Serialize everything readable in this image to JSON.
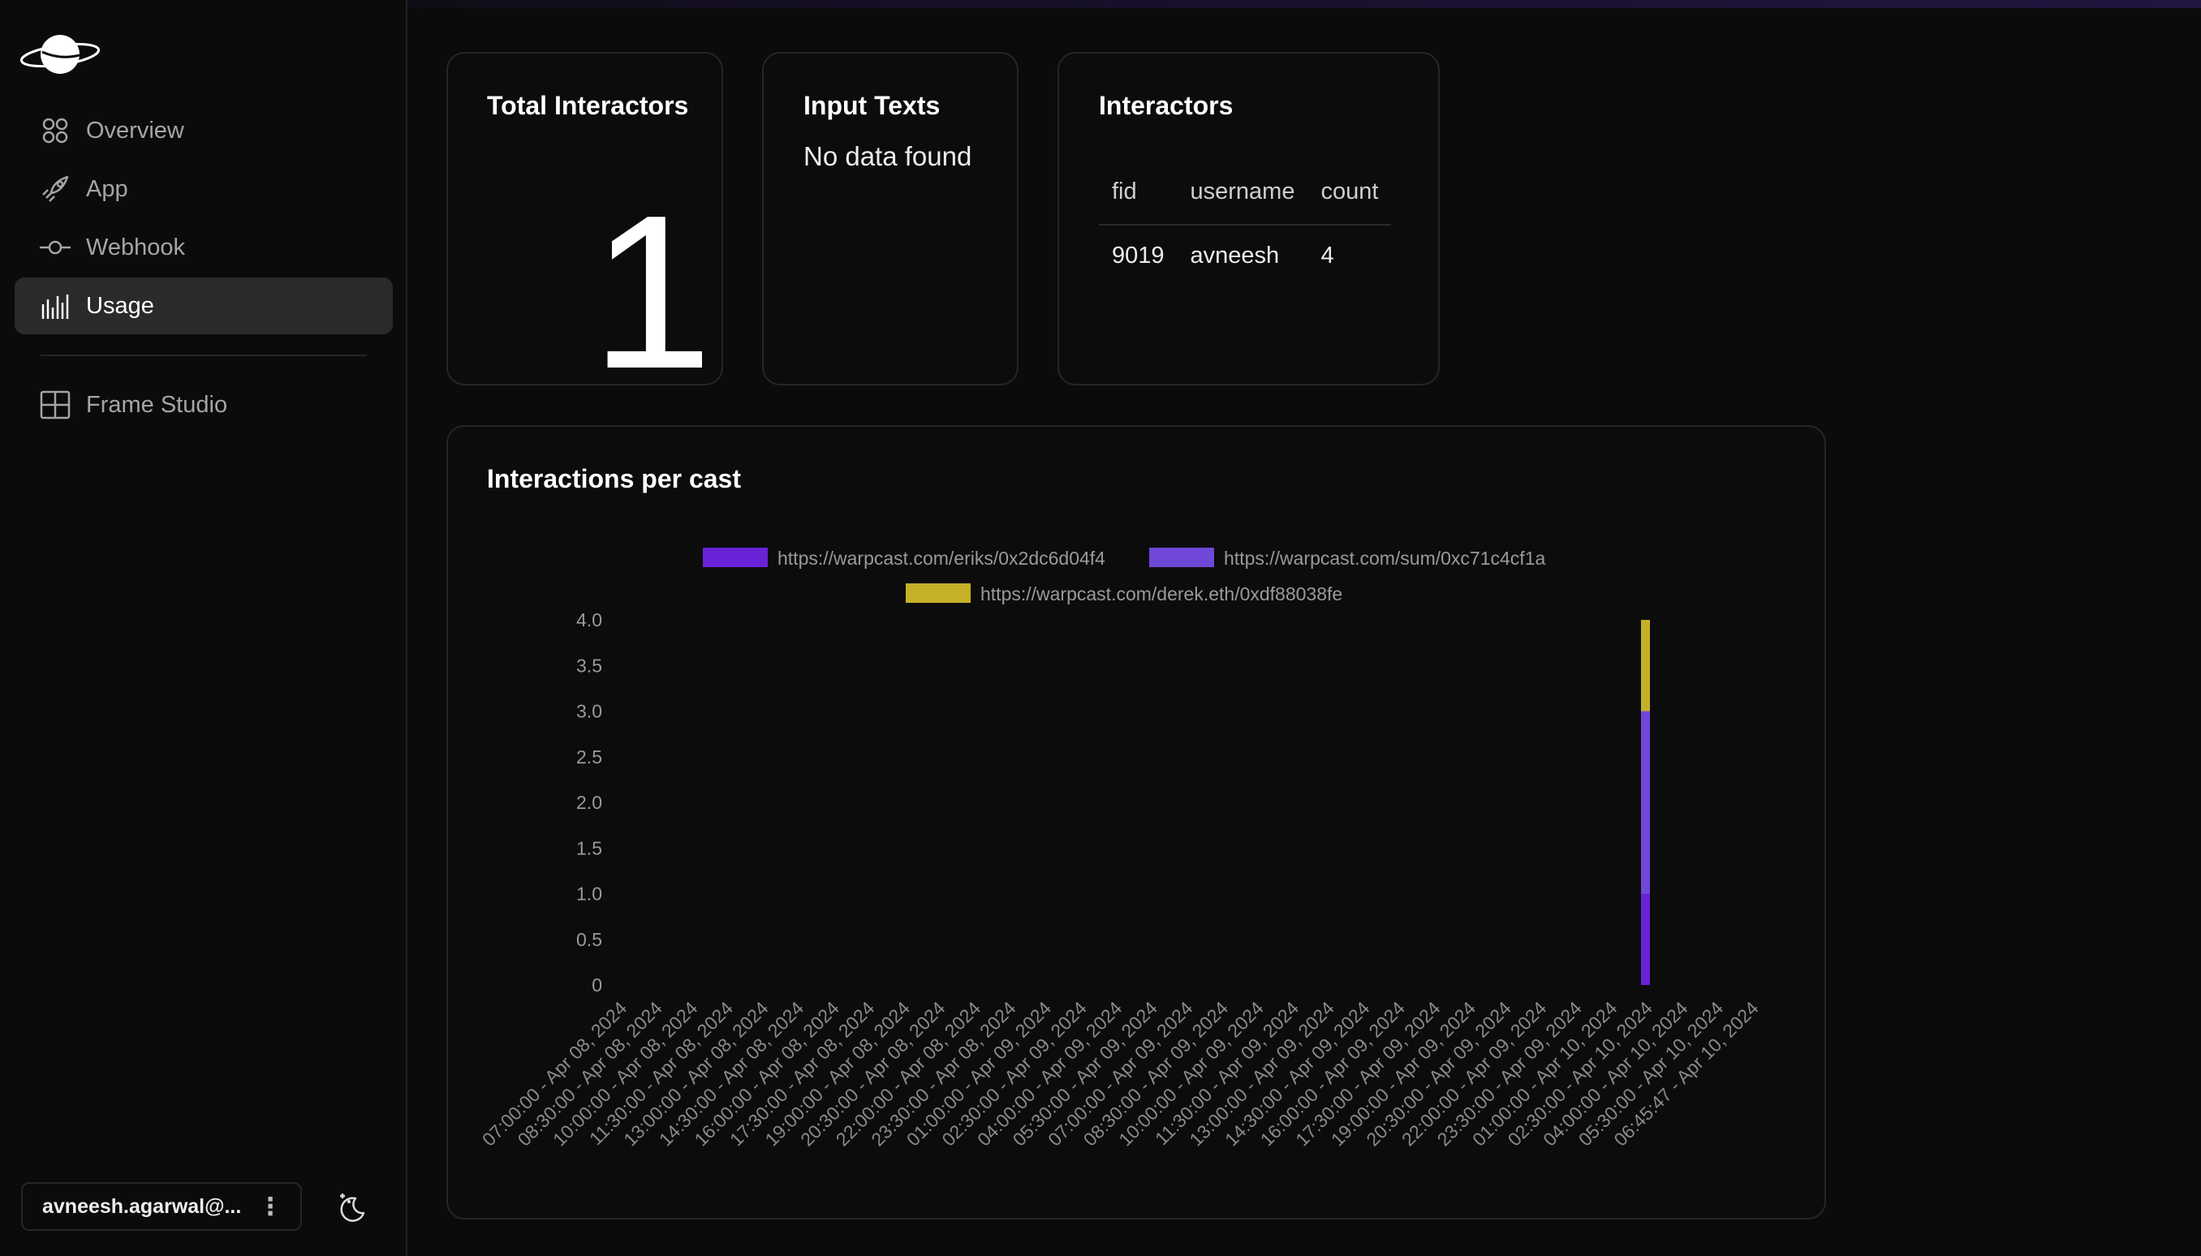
{
  "sidebar": {
    "items": [
      {
        "label": "Overview",
        "icon": "grid-circles-icon"
      },
      {
        "label": "App",
        "icon": "rocket-icon"
      },
      {
        "label": "Webhook",
        "icon": "webhook-icon"
      },
      {
        "label": "Usage",
        "icon": "bar-chart-icon",
        "active": true
      },
      {
        "label": "Frame Studio",
        "icon": "layout-grid-icon"
      }
    ],
    "user": "avneesh.agarwal@...",
    "theme_icon": "moon-stars-icon"
  },
  "cards": {
    "total_interactors": {
      "title": "Total Interactors",
      "value": "1"
    },
    "input_texts": {
      "title": "Input Texts",
      "empty": "No data found"
    },
    "interactors": {
      "title": "Interactors",
      "columns": [
        "fid",
        "username",
        "count"
      ],
      "rows": [
        [
          "9019",
          "avneesh",
          "4"
        ]
      ]
    }
  },
  "chart_card": {
    "title": "Interactions per cast"
  },
  "chart_data": {
    "type": "bar",
    "stacked": true,
    "title": "Interactions per cast",
    "ylim": [
      0,
      4
    ],
    "yticks": [
      "0",
      "0.5",
      "1.0",
      "1.5",
      "2.0",
      "2.5",
      "3.0",
      "3.5",
      "4.0"
    ],
    "categories": [
      "07:00:00 - Apr 08, 2024",
      "08:30:00 - Apr 08, 2024",
      "10:00:00 - Apr 08, 2024",
      "11:30:00 - Apr 08, 2024",
      "13:00:00 - Apr 08, 2024",
      "14:30:00 - Apr 08, 2024",
      "16:00:00 - Apr 08, 2024",
      "17:30:00 - Apr 08, 2024",
      "19:00:00 - Apr 08, 2024",
      "20:30:00 - Apr 08, 2024",
      "22:00:00 - Apr 08, 2024",
      "23:30:00 - Apr 08, 2024",
      "01:00:00 - Apr 09, 2024",
      "02:30:00 - Apr 09, 2024",
      "04:00:00 - Apr 09, 2024",
      "05:30:00 - Apr 09, 2024",
      "07:00:00 - Apr 09, 2024",
      "08:30:00 - Apr 09, 2024",
      "10:00:00 - Apr 09, 2024",
      "11:30:00 - Apr 09, 2024",
      "13:00:00 - Apr 09, 2024",
      "14:30:00 - Apr 09, 2024",
      "16:00:00 - Apr 09, 2024",
      "17:30:00 - Apr 09, 2024",
      "19:00:00 - Apr 09, 2024",
      "20:30:00 - Apr 09, 2024",
      "22:00:00 - Apr 09, 2024",
      "23:30:00 - Apr 09, 2024",
      "01:00:00 - Apr 10, 2024",
      "02:30:00 - Apr 10, 2024",
      "04:00:00 - Apr 10, 2024",
      "05:30:00 - Apr 10, 2024",
      "06:45:47 - Apr 10, 2024"
    ],
    "series": [
      {
        "name": "https://warpcast.com/eriks/0x2dc6d04f4",
        "color": "#6a22d6",
        "values": [
          0,
          0,
          0,
          0,
          0,
          0,
          0,
          0,
          0,
          0,
          0,
          0,
          0,
          0,
          0,
          0,
          0,
          0,
          0,
          0,
          0,
          0,
          0,
          0,
          0,
          0,
          0,
          0,
          0,
          1,
          0,
          0,
          0
        ]
      },
      {
        "name": "https://warpcast.com/sum/0xc71c4cf1a",
        "color": "#7048d8",
        "values": [
          0,
          0,
          0,
          0,
          0,
          0,
          0,
          0,
          0,
          0,
          0,
          0,
          0,
          0,
          0,
          0,
          0,
          0,
          0,
          0,
          0,
          0,
          0,
          0,
          0,
          0,
          0,
          0,
          0,
          2,
          0,
          0,
          0
        ]
      },
      {
        "name": "https://warpcast.com/derek.eth/0xdf88038fe",
        "color": "#c6b027",
        "values": [
          0,
          0,
          0,
          0,
          0,
          0,
          0,
          0,
          0,
          0,
          0,
          0,
          0,
          0,
          0,
          0,
          0,
          0,
          0,
          0,
          0,
          0,
          0,
          0,
          0,
          0,
          0,
          0,
          0,
          1,
          0,
          0,
          0
        ]
      }
    ],
    "legend_position": "top",
    "grid": false
  }
}
